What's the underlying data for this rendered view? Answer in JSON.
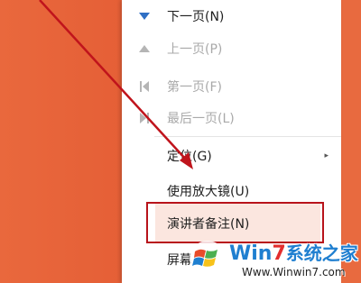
{
  "menu": {
    "items": [
      {
        "label": "下一页(N)",
        "icon": "triangle-down-icon",
        "disabled": false
      },
      {
        "label": "上一页(P)",
        "icon": "triangle-up-icon",
        "disabled": true
      },
      {
        "label": "第一页(F)",
        "icon": "first-page-icon",
        "disabled": true
      },
      {
        "label": "最后一页(L)",
        "icon": "last-page-icon",
        "disabled": true
      },
      {
        "label": "定位(G)",
        "icon": "",
        "disabled": false,
        "submenu_arrow": "▸"
      },
      {
        "label": "使用放大镜(U)",
        "icon": "",
        "disabled": false
      },
      {
        "label": "演讲者备注(N)",
        "icon": "",
        "disabled": false
      },
      {
        "label": "屏幕",
        "icon": "",
        "disabled": false
      }
    ]
  },
  "watermark": {
    "title_prefix": "Win",
    "title_seven": "7",
    "title_cn": "系统之家",
    "url": "Www.Winwin7.com"
  },
  "colors": {
    "background": "#e55f36",
    "highlight_border": "#b8131b",
    "arrow": "#c0141c",
    "icon_blue": "#2f6fc4"
  }
}
